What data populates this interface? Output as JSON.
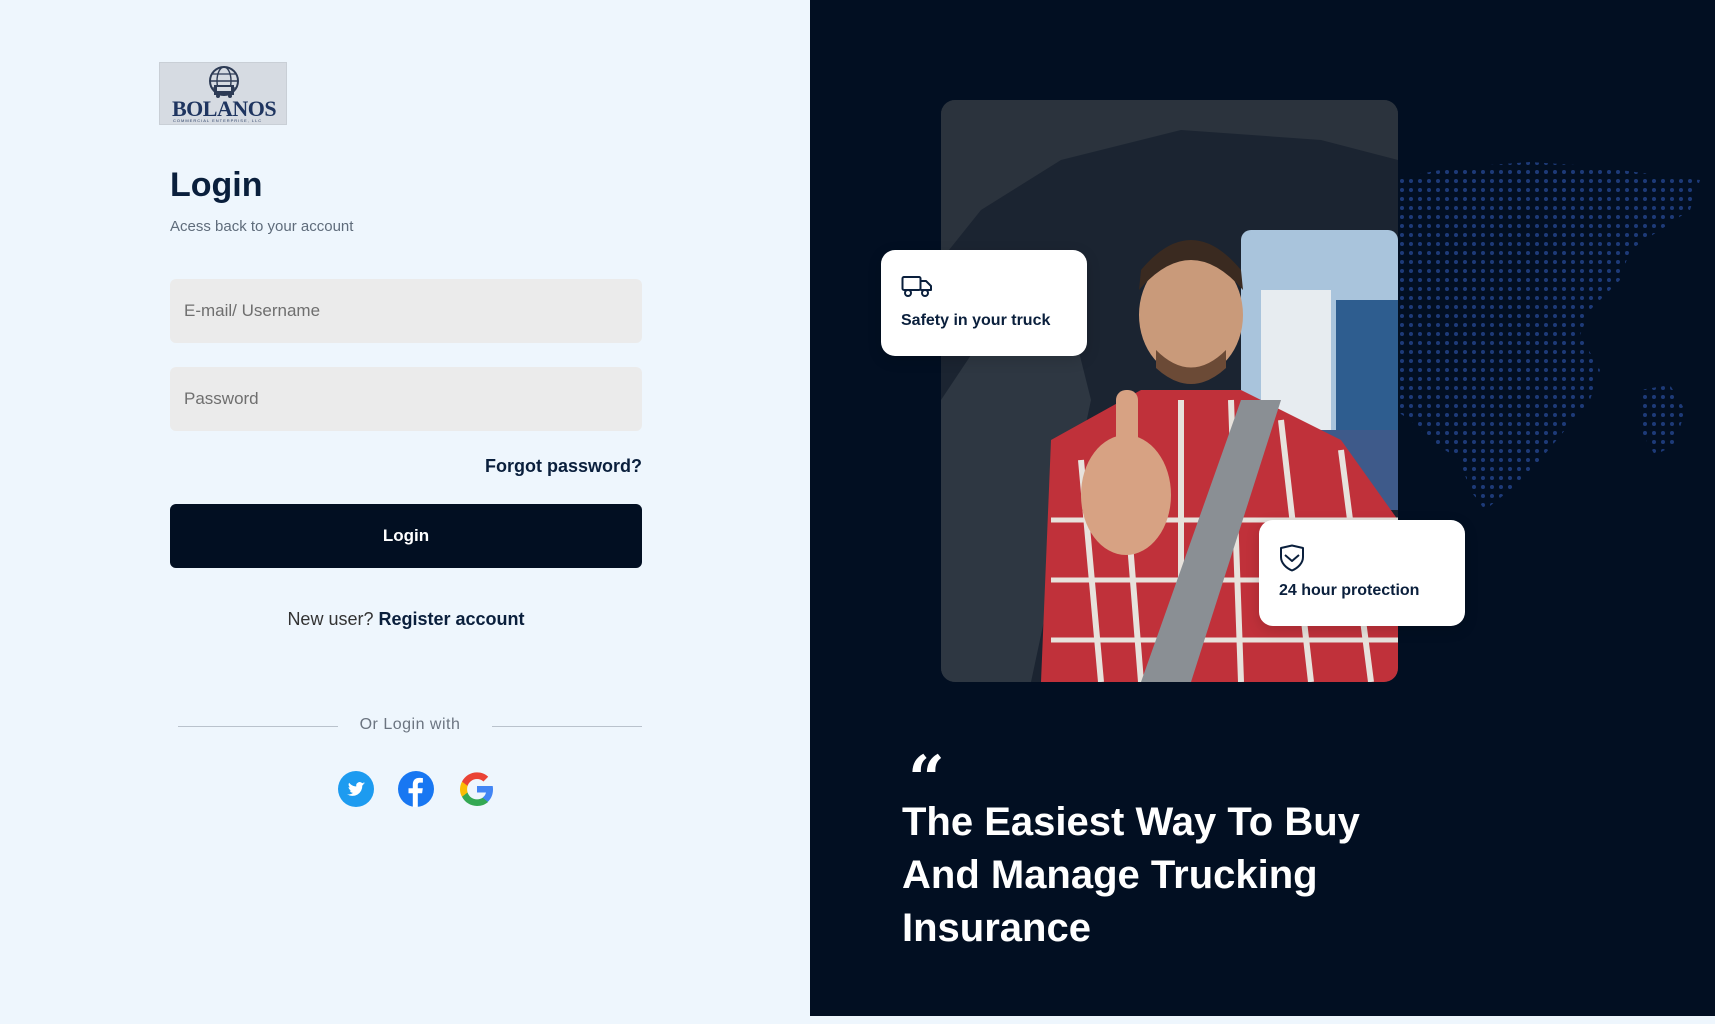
{
  "logo": {
    "word": "BOLANOS",
    "subtext": "COMMERCIAL ENTERPRISE, LLC"
  },
  "login": {
    "title": "Login",
    "subtitle": "Acess back to your account",
    "email_placeholder": "E-mail/ Username",
    "password_placeholder": "Password",
    "forgot_label": "Forgot password?",
    "submit_label": "Login",
    "new_user_text": "New user?",
    "register_label": "Register account",
    "divider_text": "Or Login with"
  },
  "social": [
    {
      "icon": "twitter-icon",
      "color": "#1d9bf0"
    },
    {
      "icon": "facebook-icon",
      "color": "#1877f2"
    },
    {
      "icon": "google-icon",
      "color": "#4285f4"
    }
  ],
  "hero": {
    "card1_label": "Safety in your truck",
    "card1_icon": "truck-icon",
    "card2_label": "24 hour protection",
    "card2_icon": "shield-icon",
    "quote_mark": "“",
    "headline": "The Easiest Way To Buy And Manage Trucking Insurance"
  },
  "colors": {
    "dark": "#020f22",
    "panel": "#eef6fd",
    "field": "#ebebeb"
  }
}
